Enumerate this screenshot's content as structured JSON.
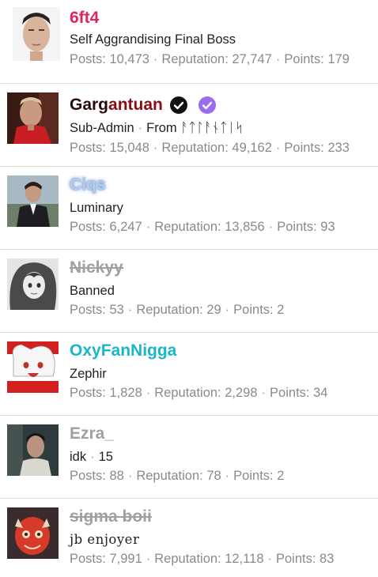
{
  "members": [
    {
      "name": "6ft4",
      "name_color": "#e0245e",
      "title": "Self Aggrandising Final Boss",
      "posts_label": "Posts:",
      "posts": "10,473",
      "rep_label": "Reputation:",
      "rep": "27,747",
      "points_label": "Points:",
      "points": "179"
    },
    {
      "name_part1": "Garg",
      "name_part2": "antuan",
      "name_color1": "#2b0808",
      "name_color2": "#8b0d12",
      "title_prefix": "Sub-Admin",
      "title_suffix": "From ᚨᛏᛚᚨᚾᛏᛁᛋ",
      "badges": [
        "check-circle-black-icon",
        "check-circle-purple-icon"
      ],
      "posts_label": "Posts:",
      "posts": "15,048",
      "rep_label": "Reputation:",
      "rep": "49,162",
      "points_label": "Points:",
      "points": "233"
    },
    {
      "name": "Ciqs",
      "name_color": "#b8cce4",
      "title": "Luminary",
      "posts_label": "Posts:",
      "posts": "6,247",
      "rep_label": "Reputation:",
      "rep": "13,856",
      "points_label": "Points:",
      "points": "93"
    },
    {
      "name": "Nickyy",
      "name_color": "#a0a0a0",
      "title": "Banned",
      "posts_label": "Posts:",
      "posts": "53",
      "rep_label": "Reputation:",
      "rep": "29",
      "points_label": "Points:",
      "points": "2"
    },
    {
      "name": "OxyFanNigga",
      "name_color": "#1ab5c8",
      "title": "Zephir",
      "posts_label": "Posts:",
      "posts": "1,828",
      "rep_label": "Reputation:",
      "rep": "2,298",
      "points_label": "Points:",
      "points": "34"
    },
    {
      "name": "Ezra_",
      "name_color": "#a0a0a0",
      "title_prefix": "idk",
      "title_suffix": "15",
      "posts_label": "Posts:",
      "posts": "88",
      "rep_label": "Reputation:",
      "rep": "78",
      "points_label": "Points:",
      "points": "2"
    },
    {
      "name": "sigma boii",
      "name_color": "#a0a0a0",
      "title": "jb enjoyer",
      "posts_label": "Posts:",
      "posts": "7,991",
      "rep_label": "Reputation:",
      "rep": "12,118",
      "points_label": "Points:",
      "points": "83"
    }
  ],
  "separator": "·"
}
